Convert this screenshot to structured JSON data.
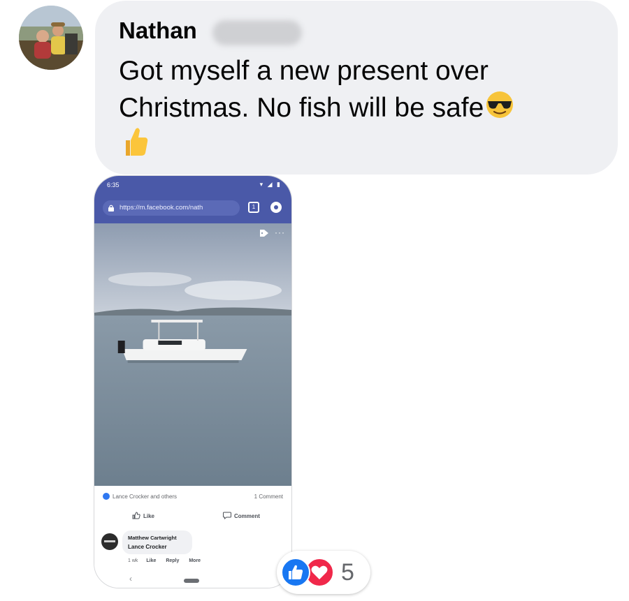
{
  "message": {
    "sender_name": "Nathan",
    "text": "Got myself a new present over Christmas. No fish will be safe",
    "emojis": [
      "sunglasses-face-icon",
      "thumbs-up-icon"
    ]
  },
  "attachment": {
    "status_time": "6:35",
    "url": "https://m.facebook.com/nath",
    "reaction_names": "Lance Crocker and others",
    "comment_count": "1 Comment",
    "like_label": "Like",
    "comment_label": "Comment",
    "comment": {
      "author": "Matthew Cartwright",
      "text": "Lance Crocker",
      "age": "1 wk",
      "like": "Like",
      "reply": "Reply",
      "more": "More"
    }
  },
  "reactions": {
    "icons": [
      "like-icon",
      "love-icon"
    ],
    "count": "5"
  },
  "colors": {
    "bubble": "#eff0f3",
    "facebook_header": "#4a59a8",
    "like_blue": "#1877f2",
    "love_red": "#f0284a"
  }
}
